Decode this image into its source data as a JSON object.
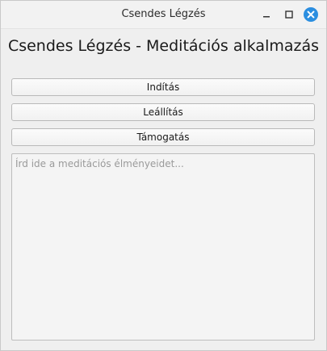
{
  "window": {
    "title": "Csendes Légzés"
  },
  "title_controls": {
    "minimize_icon": "minimize-icon",
    "maximize_icon": "maximize-icon",
    "close_icon": "close-icon",
    "close_color": "#2b8ee0"
  },
  "main": {
    "heading": "Csendes Légzés - Meditációs alkalmazás",
    "buttons": {
      "start": "Indítás",
      "stop": "Leállítás",
      "support": "Támogatás"
    },
    "notes": {
      "value": "",
      "placeholder": "Írd ide a meditációs élményeidet..."
    }
  }
}
